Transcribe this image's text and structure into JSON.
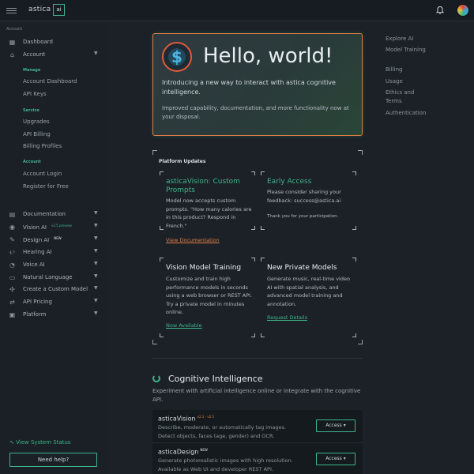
{
  "topbar": {
    "brand": "astica",
    "brand_badge": "ai"
  },
  "sidebar": {
    "section_account": "Account",
    "dashboard": "Dashboard",
    "account": "Account",
    "manage_title": "Manage",
    "manage_items": [
      "Account Dashboard",
      "API Keys"
    ],
    "service_title": "Service",
    "service_items": [
      "Upgrades",
      "API Billing",
      "Billing Profiles"
    ],
    "account_title": "Account",
    "account_items": [
      "Account Login",
      "Register for Free"
    ],
    "nav": [
      {
        "label": "Documentation",
        "tag": ""
      },
      {
        "label": "Vision AI",
        "tag": "v2.5 preview"
      },
      {
        "label": "Design AI",
        "tag": "NEW"
      },
      {
        "label": "Hearing AI",
        "tag": ""
      },
      {
        "label": "Voice AI",
        "tag": ""
      },
      {
        "label": "Natural Language",
        "tag": ""
      },
      {
        "label": "Create a Custom Model",
        "tag": ""
      },
      {
        "label": "API Pricing",
        "tag": ""
      },
      {
        "label": "Platform",
        "tag": ""
      }
    ],
    "status": "View System Status",
    "help": "Need help?"
  },
  "toc": [
    "Explore AI",
    "Model Training",
    "Billing",
    "Usage",
    "Ethics and",
    "Terms",
    "Authentication"
  ],
  "hero": {
    "title": "Hello, world!",
    "intro": "Introducing a new way to interact with astica cognitive intelligence.",
    "more": "Improved capability, documentation, and more functionality now at your disposal."
  },
  "updates": {
    "title": "Platform Updates",
    "cards": [
      {
        "title": "asticaVision: Custom Prompts",
        "body": "Model now accepts custom prompts. \"How many calories are in this product? Respond in French.\"",
        "link": "View Documentation"
      },
      {
        "title": "Early Access",
        "body": "Please consider sharing your feedback: success@astica.ai",
        "note": "Thank you for your participation."
      },
      {
        "title": "Vision Model Training",
        "body": "Customize and train high performance models in seconds using a web browser or REST API. Try a private model in minutes online.",
        "link": "Now Available"
      },
      {
        "title": "New Private Models",
        "body": "Generate music, real-time video AI with spatial analysis, and advanced model training and annotation.",
        "link": "Request Details"
      }
    ]
  },
  "cognitive": {
    "title": "Cognitive Intelligence",
    "desc": "Experiment with artificial intelligence online or integrate with the cognitive API.",
    "products": [
      {
        "name": "asticaVision",
        "tag": "v2.1 - v2.5",
        "desc": "Describe, moderate, or automatically tag images. Detect objects, faces (age, gender) and OCR.",
        "action": "Access"
      },
      {
        "name": "asticaDesign",
        "tag": "NEW",
        "desc": "Generate photorealistic images with high resolution. Available as Web UI and developer REST API.",
        "action": "Access"
      }
    ]
  }
}
